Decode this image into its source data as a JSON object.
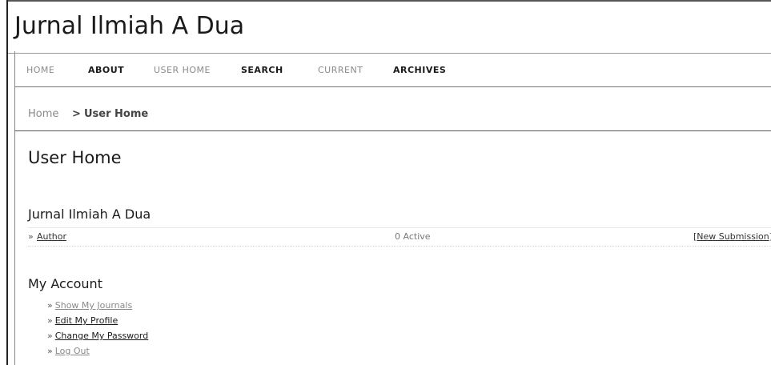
{
  "site": {
    "title": "Jurnal Ilmiah A Dua"
  },
  "nav": {
    "items": [
      {
        "label": "HOME"
      },
      {
        "label": "ABOUT"
      },
      {
        "label": "USER HOME"
      },
      {
        "label": "SEARCH"
      },
      {
        "label": "CURRENT"
      },
      {
        "label": "ARCHIVES"
      }
    ]
  },
  "breadcrumb": {
    "home": "Home",
    "separator": ">",
    "current": "User Home"
  },
  "page": {
    "title": "User Home"
  },
  "journal": {
    "name": "Jurnal Ilmiah A Dua",
    "role": {
      "bullet": "»",
      "label": "Author",
      "active": "0 Active",
      "action_open": "[",
      "action": "New Submission",
      "action_close": "]"
    }
  },
  "account": {
    "heading": "My Account",
    "bullet": "»",
    "links": [
      {
        "label": "Show My Journals"
      },
      {
        "label": "Edit My Profile"
      },
      {
        "label": "Change My Password"
      },
      {
        "label": "Log Out"
      }
    ]
  }
}
